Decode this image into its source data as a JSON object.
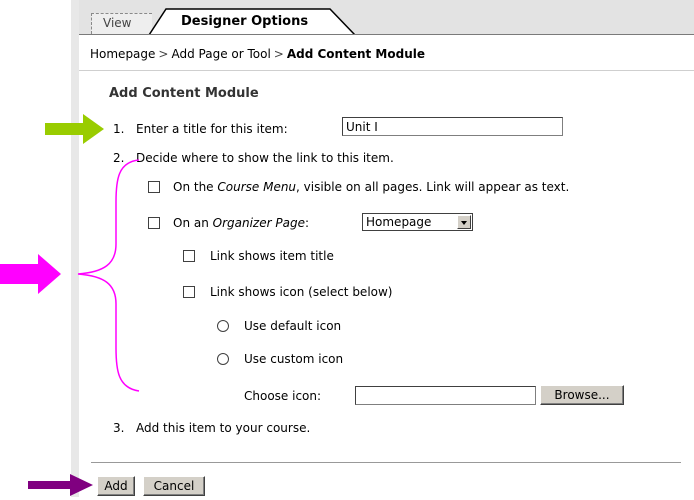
{
  "tabs": {
    "view": "View",
    "designer": "Designer Options"
  },
  "breadcrumb": {
    "item1": "Homepage",
    "sep": ">",
    "item2": "Add Page or Tool",
    "current": "Add Content Module"
  },
  "page_title": "Add Content Module",
  "step1": {
    "number": "1.",
    "label": "Enter a title for this item:",
    "value": "Unit I"
  },
  "step2": {
    "number": "2.",
    "label": "Decide where to show the link to this item.",
    "course_menu": {
      "prefix": "On the ",
      "emph": "Course Menu",
      "suffix": ", visible on all pages. Link will appear as text."
    },
    "organizer": {
      "prefix": "On an ",
      "emph": "Organizer Page",
      "suffix": ":",
      "selected": "Homepage"
    },
    "link_title": "Link shows item title",
    "link_icon": "Link shows icon (select below)",
    "default_icon": "Use default icon",
    "custom_icon": "Use custom icon",
    "choose_icon": "Choose icon:",
    "browse": "Browse..."
  },
  "step3": {
    "number": "3.",
    "label": "Add this item to your course."
  },
  "buttons": {
    "add": "Add",
    "cancel": "Cancel"
  },
  "colors": {
    "green_arrow": "#99cc00",
    "magenta_arrow": "#ff00ff",
    "purple_arrow": "#800080",
    "brace": "#ff00ff"
  }
}
